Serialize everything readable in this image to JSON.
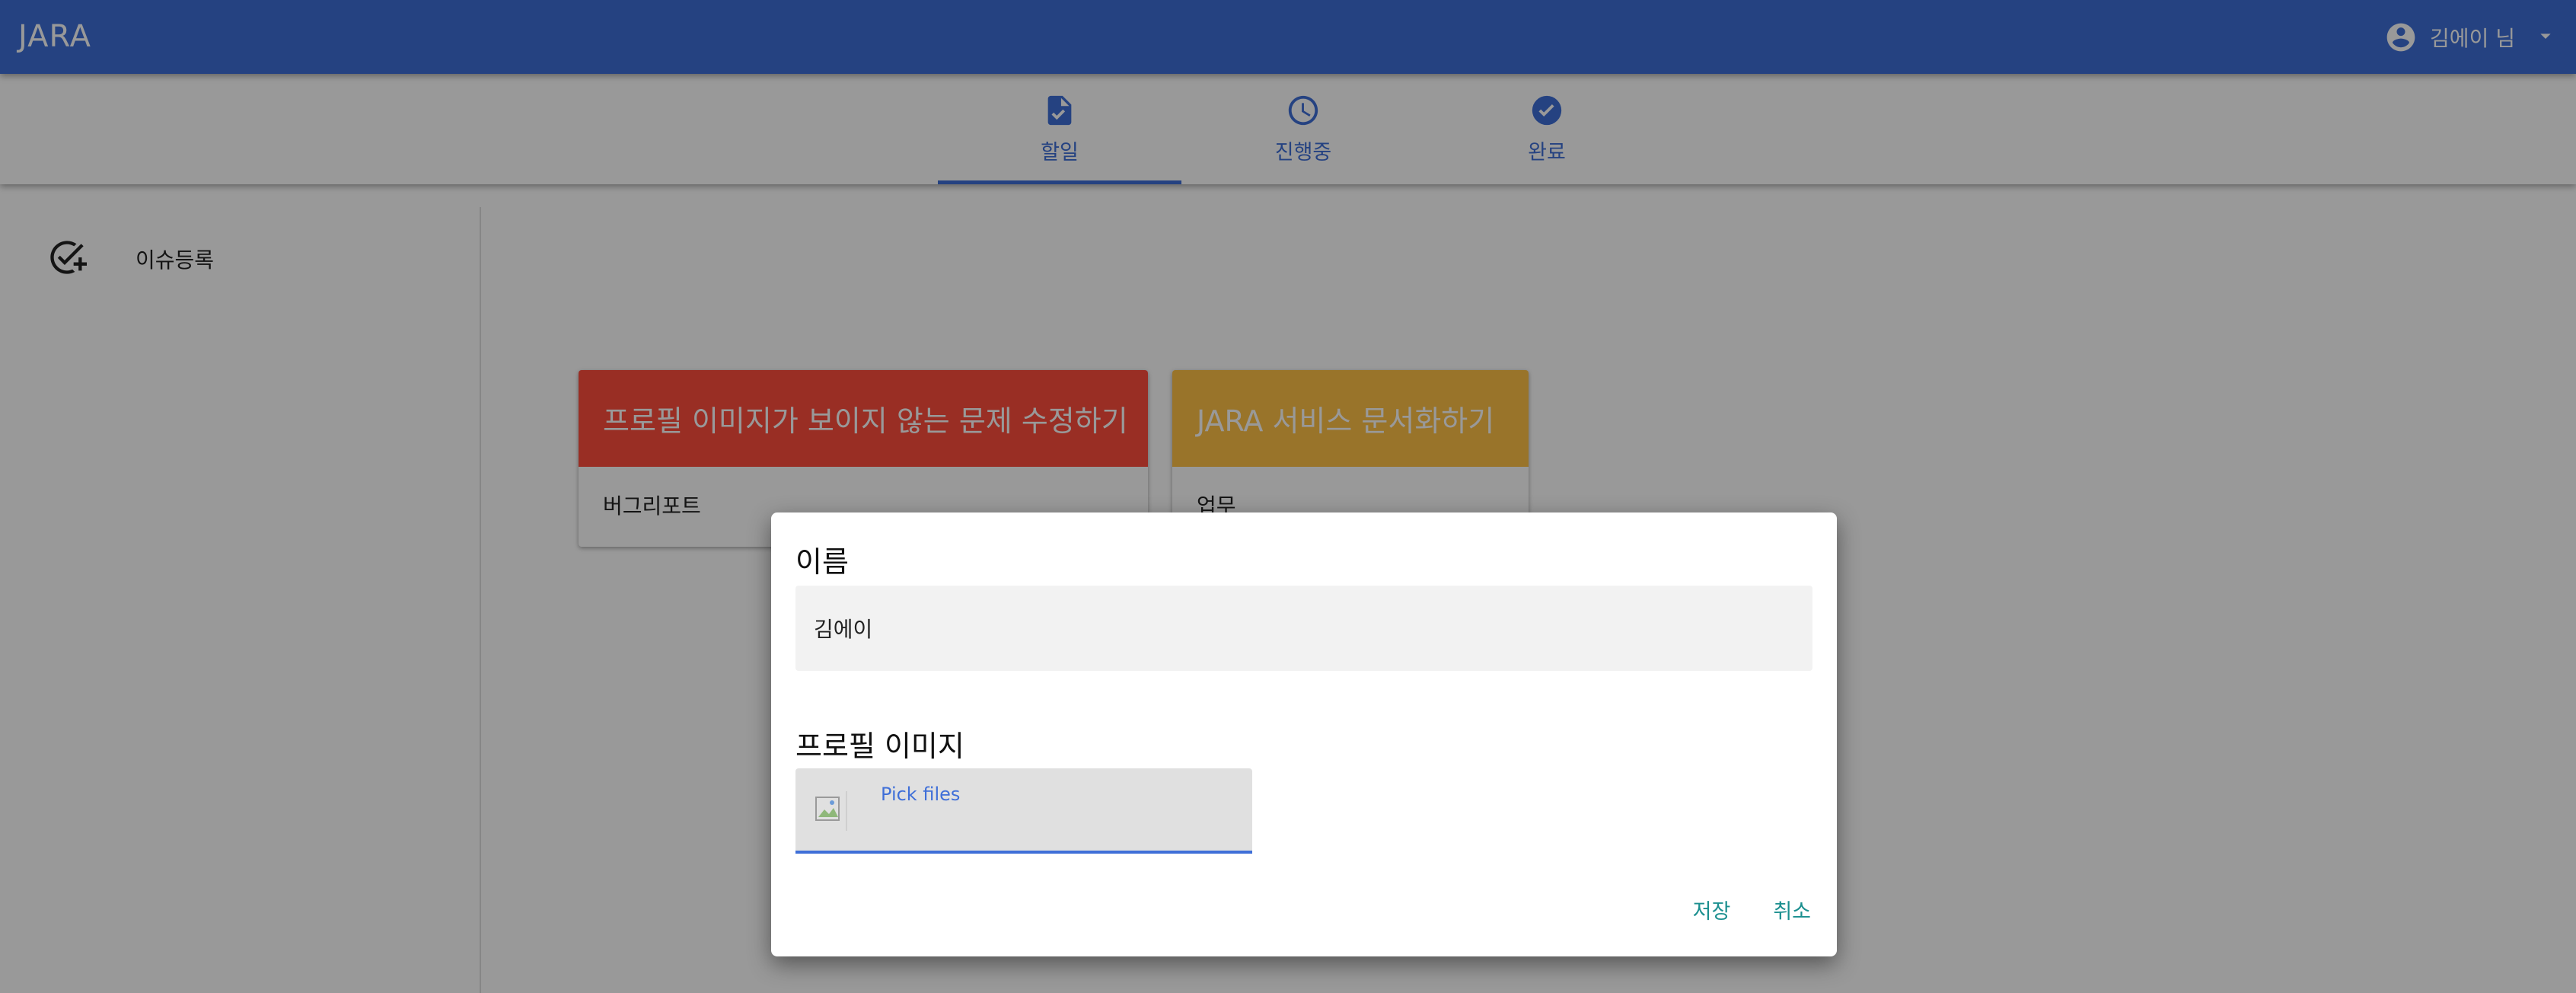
{
  "app": {
    "title": "JARA",
    "user_name": "김에이 님"
  },
  "tabs": [
    {
      "label": "할일",
      "icon": "document-check-icon",
      "active": true
    },
    {
      "label": "진행중",
      "icon": "clock-icon",
      "active": false
    },
    {
      "label": "완료",
      "icon": "check-circle-icon",
      "active": false
    }
  ],
  "sidebar": {
    "items": [
      {
        "label": "이슈등록",
        "icon": "add-task-icon"
      }
    ]
  },
  "cards": [
    {
      "title": "프로필 이미지가 보이지 않는 문제 수정하기",
      "type": "버그리포트",
      "color": "#ff4d3d"
    },
    {
      "title": "JARA 서비스 문서화하기",
      "type": "업무",
      "color": "#ffc247"
    }
  ],
  "dialog": {
    "name_label": "이름",
    "name_value": "김에이",
    "image_label": "프로필 이미지",
    "pick_files_label": "Pick files",
    "save_label": "저장",
    "cancel_label": "취소"
  },
  "colors": {
    "primary": "#3f6fd8",
    "action": "#1b8f8f",
    "bug": "#ff4d3d",
    "task": "#ffc247"
  }
}
